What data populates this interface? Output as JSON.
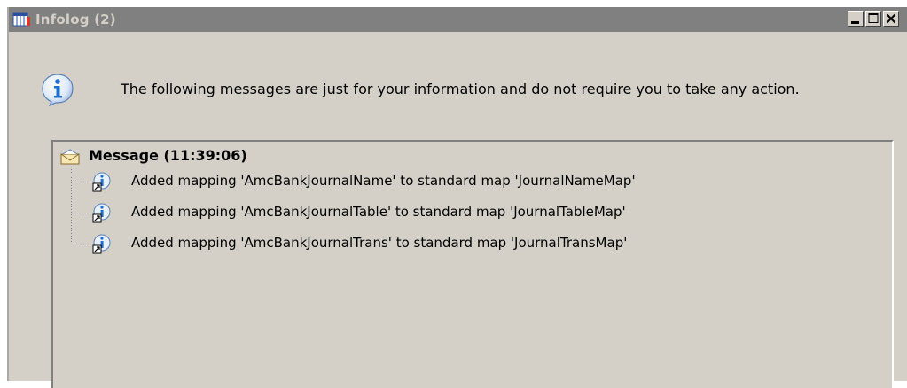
{
  "window": {
    "title": "Infolog (2)",
    "controls": [
      "minimize",
      "maximize",
      "close"
    ]
  },
  "info": {
    "icon": "information-icon",
    "text": "The following messages are just for your information and do not require you to take any action."
  },
  "messages": {
    "group_label": "Message (11:39:06)",
    "group_icon": "message-envelope-icon",
    "items": [
      {
        "icon": "info-shortcut-icon",
        "text": "Added mapping 'AmcBankJournalName' to standard map 'JournalNameMap'"
      },
      {
        "icon": "info-shortcut-icon",
        "text": "Added mapping 'AmcBankJournalTable' to standard map 'JournalTableMap'"
      },
      {
        "icon": "info-shortcut-icon",
        "text": "Added mapping 'AmcBankJournalTrans' to standard map 'JournalTransMap'"
      }
    ]
  },
  "colors": {
    "titlebar": "#808080",
    "title_text": "#d4d0c8",
    "panel": "#d4d0c8",
    "info_blue": "#1e6fd0"
  }
}
